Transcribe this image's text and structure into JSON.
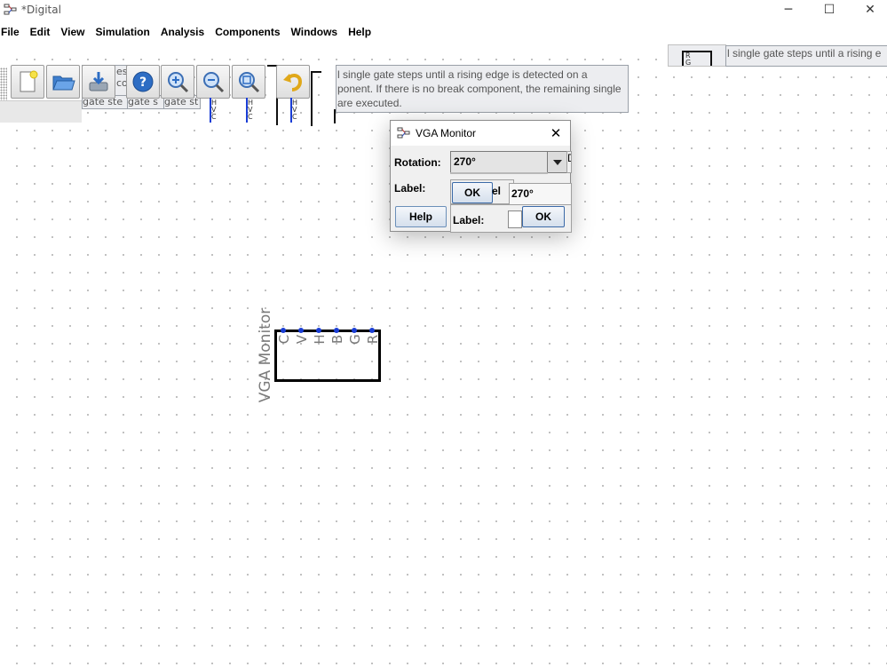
{
  "window": {
    "title": "*Digital",
    "controls": {
      "minimize": "─",
      "maximize": "☐",
      "close": "✕"
    }
  },
  "menu": [
    "File",
    "Edit",
    "View",
    "Simulation",
    "Analysis",
    "Components",
    "Windows",
    "Help"
  ],
  "toolbar": {
    "buttons": [
      "new-file-icon",
      "open-file-icon",
      "save-file-icon",
      "help-icon",
      "zoom-in-icon",
      "zoom-out-icon",
      "zoom-fit-icon",
      "undo-icon"
    ]
  },
  "tooltip": {
    "lines": [
      "l single gate steps until a rising edge is detected on a",
      "ponent. If there is no break component, the remaining single",
      "are executed."
    ],
    "right_fragment": "l single gate steps until a rising e"
  },
  "ghost_fragments": {
    "left_top": "es",
    "left_mid": "co",
    "left_bottom": "gate ste",
    "mid1": "gate s",
    "mid2": "gate st"
  },
  "mini_components": {
    "pins": [
      "H",
      "V",
      "C"
    ],
    "right_box_pins": [
      "R",
      "G"
    ]
  },
  "dialog": {
    "title": "VGA Monitor",
    "close": "✕",
    "rotation_label": "Rotation:",
    "rotation_value": "270°",
    "label_label": "Label:",
    "ok": "OK",
    "help": "Help",
    "ghost": {
      "ok1": "OK",
      "frag_el": "el",
      "value_dup": "270°",
      "label_dup": "Label:",
      "ok2": "OK",
      "side_letter": "D"
    }
  },
  "component": {
    "label": "VGA Monitor",
    "pins": [
      "C",
      "V",
      "H",
      "B",
      "G",
      "R"
    ]
  },
  "colors": {
    "pin_blue": "#1a3ed6",
    "tooltip_bg": "#ecedf0",
    "dialog_bg": "#f0f0f0"
  }
}
